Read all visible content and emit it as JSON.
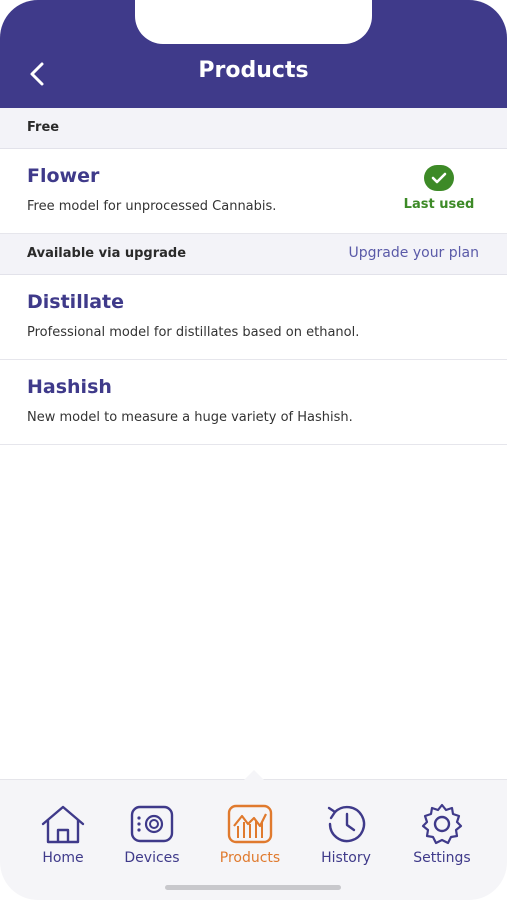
{
  "header": {
    "title": "Products",
    "back_icon": "chevron-left-icon"
  },
  "sections": {
    "free": {
      "label": "Free"
    },
    "upgrade": {
      "label": "Available via upgrade",
      "link": "Upgrade your plan"
    }
  },
  "items": [
    {
      "name": "Flower",
      "description": "Free model for unprocessed Cannabis.",
      "badge": "Last used"
    },
    {
      "name": "Distillate",
      "description": "Professional model for distillates based on ethanol."
    },
    {
      "name": "Hashish",
      "description": "New model to measure a huge variety of Hashish."
    }
  ],
  "tabbar": {
    "items": [
      {
        "label": "Home",
        "icon": "home-icon"
      },
      {
        "label": "Devices",
        "icon": "device-icon"
      },
      {
        "label": "Products",
        "icon": "chart-icon",
        "active": true
      },
      {
        "label": "History",
        "icon": "history-icon"
      },
      {
        "label": "Settings",
        "icon": "gear-icon"
      }
    ]
  },
  "colors": {
    "brand": "#3f3a8a",
    "active_tab": "#e07a2e",
    "success": "#3d8a27"
  }
}
